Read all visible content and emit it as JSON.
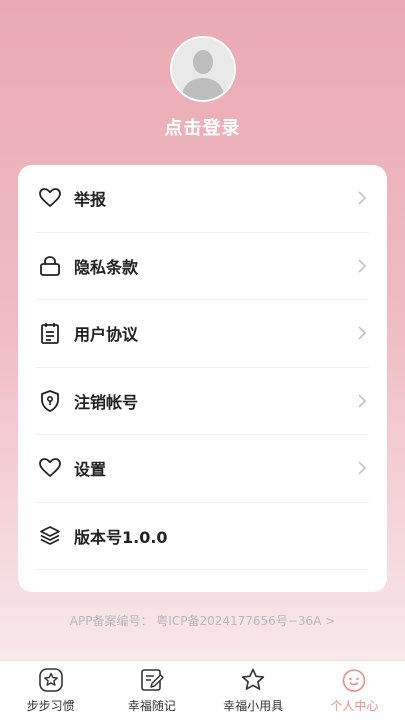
{
  "profile": {
    "login_label": "点击登录"
  },
  "menu": {
    "items": [
      {
        "label": "举报",
        "icon": "heart-icon"
      },
      {
        "label": "隐私条款",
        "icon": "lock-icon"
      },
      {
        "label": "用户协议",
        "icon": "document-icon"
      },
      {
        "label": "注销帐号",
        "icon": "shield-icon"
      },
      {
        "label": "设置",
        "icon": "heart-icon"
      },
      {
        "label": "版本号1.0.0",
        "icon": "layers-icon"
      }
    ]
  },
  "footer": {
    "icp": "APP备案编号：  粤ICP备2024177656号−36A >"
  },
  "tabbar": {
    "tabs": [
      {
        "label": "步步习惯",
        "icon": "star-badge-icon"
      },
      {
        "label": "幸福随记",
        "icon": "note-edit-icon"
      },
      {
        "label": "幸福小用具",
        "icon": "star-icon"
      },
      {
        "label": "个人中心",
        "icon": "smile-face-icon",
        "active": true
      }
    ],
    "active_color": "#f08a8a"
  }
}
